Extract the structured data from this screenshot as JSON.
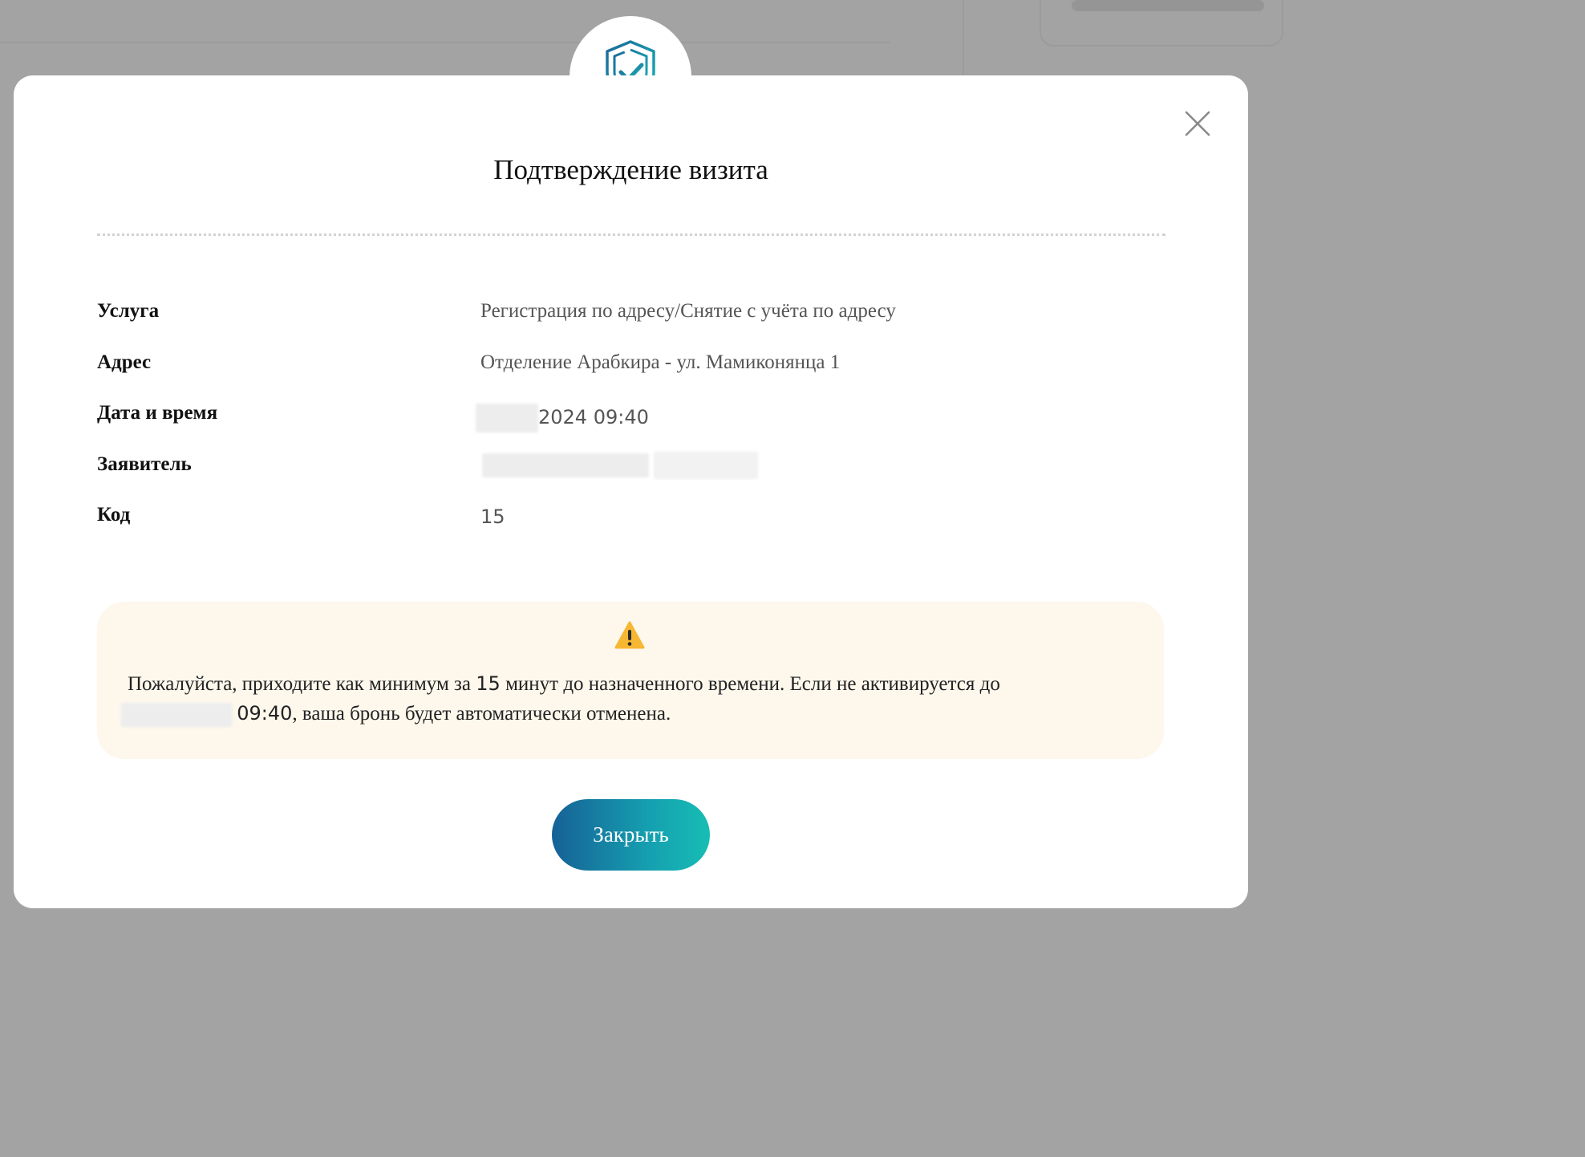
{
  "modal": {
    "title": "Подтверждение визита",
    "close_icon": "close-icon",
    "badge_icon": "shield-check-icon"
  },
  "details": [
    {
      "label": "Услуга",
      "value": "Регистрация по адресу/Снятие с учёта по адресу"
    },
    {
      "label": "Адрес",
      "value": "Отделение Арабкира - ул. Мамиконянца 1"
    },
    {
      "label": "Дата и время",
      "value": "2024 09:40"
    },
    {
      "label": "Заявитель",
      "value": ""
    },
    {
      "label": "Код",
      "value": "15"
    }
  ],
  "warning": {
    "icon": "warning-icon",
    "text_before": "Пожалуйста, приходите как минимум за ",
    "minutes": "15",
    "text_middle": " минут до назначенного времени. Если не активируется до",
    "time": "09:40",
    "text_after": ", ваша бронь будет автоматически отменена."
  },
  "actions": {
    "close_label": "Закрыть"
  },
  "colors": {
    "button_gradient_start": "#166196",
    "button_gradient_end": "#17bdb4",
    "warning_background": "#fdf7ec",
    "warning_icon": "#f6b733"
  }
}
